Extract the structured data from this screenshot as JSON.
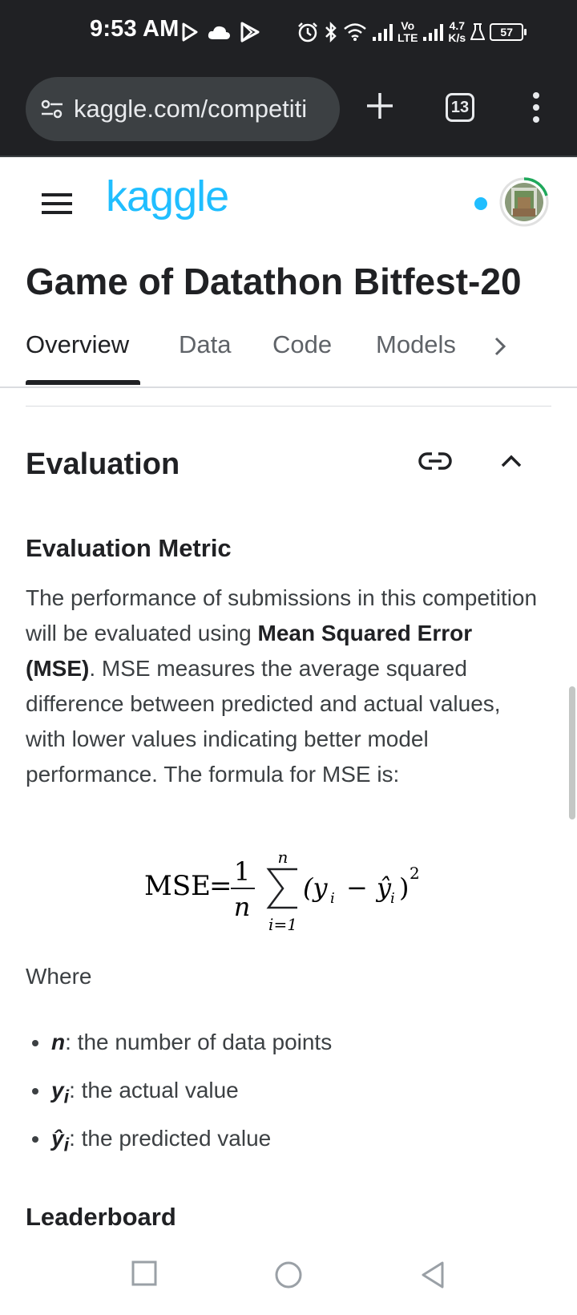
{
  "status_bar": {
    "time": "9:53 AM",
    "network_speed_value": "4.7",
    "network_speed_unit": "K/s",
    "volte_top": "Vo",
    "volte_bottom": "LTE",
    "battery": "57"
  },
  "browser": {
    "url": "kaggle.com/competiti",
    "tab_count": "13"
  },
  "kaggle": {
    "logo": "kaggle",
    "competition_title": "Game of Datathon Bitfest-20",
    "tabs": [
      "Overview",
      "Data",
      "Code",
      "Models"
    ]
  },
  "content": {
    "section_heading": "Evaluation",
    "subheading": "Evaluation Metric",
    "paragraph_part1": "The performance of submissions in this competition will be evaluated using ",
    "paragraph_bold": "Mean Squared Error (MSE)",
    "paragraph_part2": ". MSE measures the average squared difference between predicted and actual values, with lower values indicating better model performance. The formula for MSE is:",
    "formula": {
      "lhs": "MSE",
      "equals": "=",
      "numerator": "1",
      "denominator": "n",
      "sum_upper": "n",
      "sum_lower": "i=1",
      "body": "(y",
      "sub_i": "i",
      "minus": "−",
      "yhat": "ŷ",
      "close": ")",
      "power": "2"
    },
    "where_label": "Where",
    "bullets": [
      {
        "var": "n",
        "sub": "",
        "desc": ": the number of data points"
      },
      {
        "var": "y",
        "sub": "i",
        "desc": ": the actual value"
      },
      {
        "var": "ŷ",
        "sub": "i",
        "desc": ": the predicted value"
      }
    ],
    "next_heading": "Leaderboard"
  },
  "colors": {
    "brand": "#20BEFF",
    "dark": "#202124",
    "progress_ring": "#1fa85b"
  }
}
